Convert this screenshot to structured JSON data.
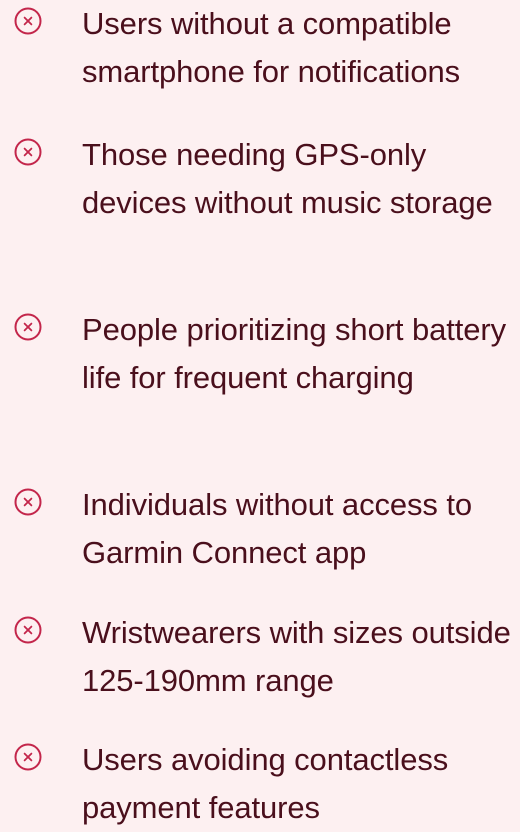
{
  "accent_color": "#c3264b",
  "text_color": "#4a0f1c",
  "background_color": "#fdf0f1",
  "icon": "circle-x-icon",
  "items": [
    {
      "text": "Users without a compatible smartphone for notifications"
    },
    {
      "text": "Those needing GPS-only devices without music storage"
    },
    {
      "text": "People prioritizing short battery life for frequent charging"
    },
    {
      "text": "Individuals without access to Garmin Connect app"
    },
    {
      "text": "Wristwearers with sizes outside 125-190mm range"
    },
    {
      "text": "Users avoiding contactless payment features"
    }
  ]
}
